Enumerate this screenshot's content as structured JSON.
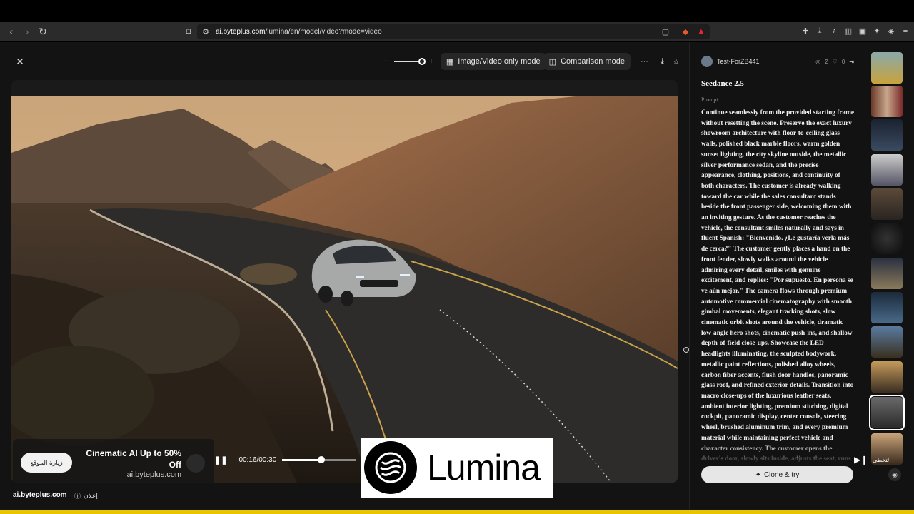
{
  "browser": {
    "url_host": "ai.byteplus.com",
    "url_path": "/lumina/en/model/video?mode=video"
  },
  "toolbar": {
    "zoom_minus": "−",
    "zoom_plus": "+",
    "image_video_mode": "Image/Video only mode",
    "comparison_mode": "Comparison mode",
    "more": "···"
  },
  "player": {
    "time": "00:16/00:30",
    "progress": 0.53
  },
  "ad": {
    "visit_label": "زيارة الموقع",
    "title": "Cinematic AI Up to 50% Off",
    "site": "ai.byteplus.com"
  },
  "logo": {
    "text": "Lumina"
  },
  "footer": {
    "site": "ai.byteplus.com",
    "ad_label": "إعلان"
  },
  "side": {
    "username": "Test-ForZB441",
    "views": "2",
    "likes": "0",
    "model": "Seedance 2.5",
    "prompt_label": "Prompt",
    "prompt": "Continue seamlessly from the provided starting frame without resetting the scene. Preserve the exact luxury showroom architecture with floor-to-ceiling glass walls, polished black marble floors, warm golden sunset lighting, the city skyline outside, the metallic silver performance sedan, and the precise appearance, clothing, positions, and continuity of both characters. The customer is already walking toward the car while the sales consultant stands beside the front passenger side, welcoming them with an inviting gesture. As the customer reaches the vehicle, the consultant smiles naturally and says in fluent Spanish: \"Bienvenido. ¿Le gustaría verla más de cerca?\" The customer gently places a hand on the front fender, slowly walks around the vehicle admiring every detail, smiles with genuine excitement, and replies: \"Por supuesto. En persona se ve aún mejor.\" The camera flows through premium automotive commercial cinematography with smooth gimbal movements, elegant tracking shots, slow cinematic orbit shots around the vehicle, dramatic low-angle hero shots, cinematic push-ins, and shallow depth-of-field close-ups. Showcase the LED headlights illuminating, the sculpted bodywork, metallic paint reflections, polished alloy wheels, carbon fiber accents, flush door handles, panoramic glass roof, and refined exterior details. Transition into macro close-ups of the luxurious leather seats, ambient interior lighting, premium stitching, digital cockpit, panoramic display, center console, steering wheel, brushed aluminum trim, and every premium material while maintaining perfect vehicle and character consistency. The customer opens the driver's door, slowly sits inside, adjusts the seat, runs a hand across the leather steering wheel, explores the digital cockpit, and smiles with admiration. The",
    "clone_label": "Clone & try"
  },
  "skip": {
    "label": "التخطي"
  },
  "colors": {
    "accent": "#e8c400",
    "bg": "#131313"
  }
}
